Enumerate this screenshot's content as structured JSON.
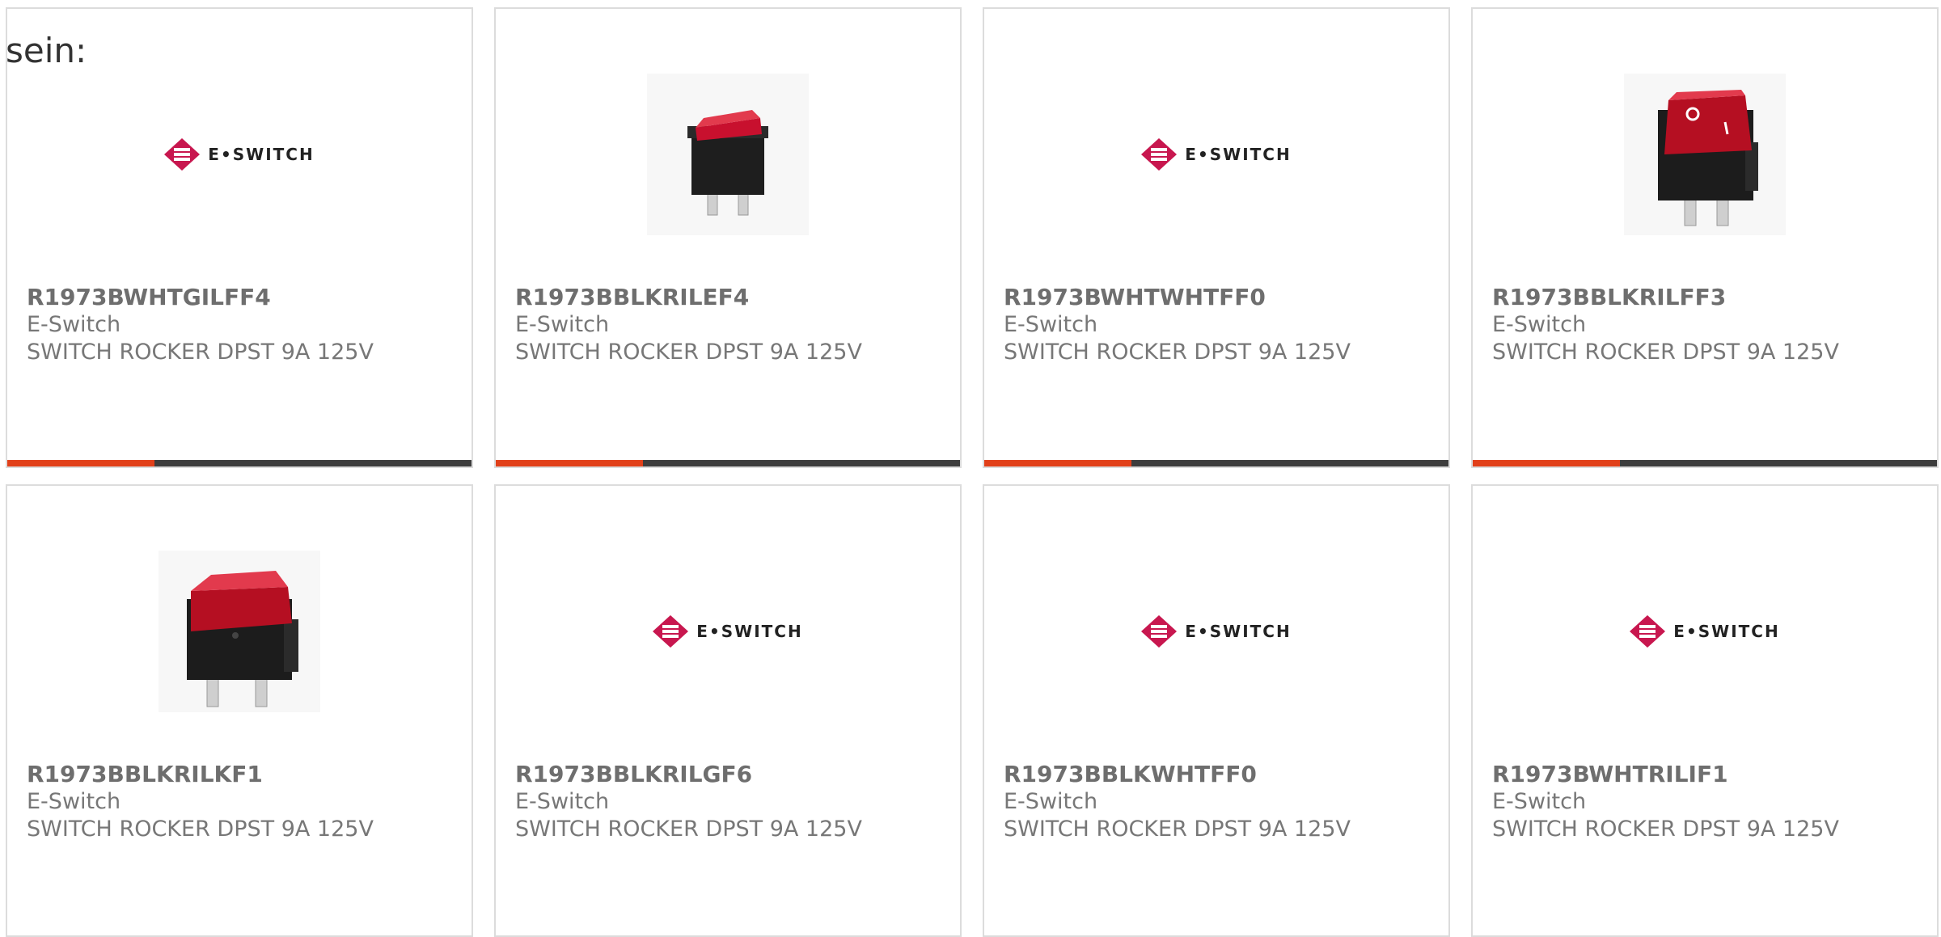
{
  "intro_text": "sein:",
  "brand": {
    "logo_text": "E•SWITCH",
    "accent": "#c8174f",
    "bar_accent": "#e1401a",
    "bar_dark": "#3d3d3d"
  },
  "products": [
    {
      "part_number": "R1973BWHTGILFF4",
      "manufacturer": "E-Switch",
      "description": "SWITCH ROCKER DPST 9A 125V",
      "image": "eswitch-logo"
    },
    {
      "part_number": "R1973BBLKRILEF4",
      "manufacturer": "E-Switch",
      "description": "SWITCH ROCKER DPST 9A 125V",
      "image": "rocker-switch-photo"
    },
    {
      "part_number": "R1973BWHTWHTFF0",
      "manufacturer": "E-Switch",
      "description": "SWITCH ROCKER DPST 9A 125V",
      "image": "eswitch-logo"
    },
    {
      "part_number": "R1973BBLKRILFF3",
      "manufacturer": "E-Switch",
      "description": "SWITCH ROCKER DPST 9A 125V",
      "image": "rocker-switch-photo-on-off"
    },
    {
      "part_number": "R1973BBLKRILKF1",
      "manufacturer": "E-Switch",
      "description": "SWITCH ROCKER DPST 9A 125V",
      "image": "rocker-switch-photo"
    },
    {
      "part_number": "R1973BBLKRILGF6",
      "manufacturer": "E-Switch",
      "description": "SWITCH ROCKER DPST 9A 125V",
      "image": "eswitch-logo"
    },
    {
      "part_number": "R1973BBLKWHTFF0",
      "manufacturer": "E-Switch",
      "description": "SWITCH ROCKER DPST 9A 125V",
      "image": "eswitch-logo"
    },
    {
      "part_number": "R1973BWHTRILIF1",
      "manufacturer": "E-Switch",
      "description": "SWITCH ROCKER DPST 9A 125V",
      "image": "eswitch-logo"
    }
  ]
}
